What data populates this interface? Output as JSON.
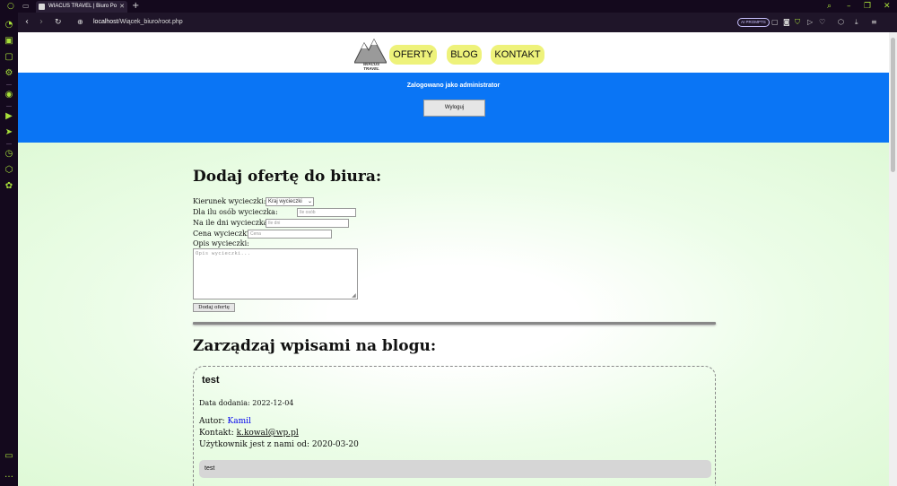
{
  "browser": {
    "tab_title": "WIACUS TRAVEL | Biuro Po",
    "url_host": "localhost",
    "url_path": "/Wiącek_biuro/root.php",
    "ai_prompts_label": "AI PROMPTS"
  },
  "nav": {
    "logo_text_line1": "WIACUS",
    "logo_text_line2": "TRAVEL",
    "items": [
      {
        "label": "OFERTY"
      },
      {
        "label": "BLOG"
      },
      {
        "label": "KONTAKT"
      }
    ]
  },
  "banner": {
    "admin_text": "Zalogowano jako administrator",
    "logout_label": "Wyloguj"
  },
  "offer_form": {
    "heading": "Dodaj ofertę do biura:",
    "direction_label": "Kierunek wycieczki:",
    "direction_value": "Kraj wycieczki",
    "people_label": "Dla ilu osób wycieczka:",
    "people_placeholder": "Ile osób",
    "days_label": "Na ile dni wycieczka:",
    "days_placeholder": "Ile dni",
    "price_label": "Cena wycieczki:",
    "price_placeholder": "Cena",
    "desc_label": "Opis wycieczki:",
    "desc_placeholder": "Opis wycieczki...",
    "submit_label": "Dodaj ofertę"
  },
  "blog": {
    "heading": "Zarządzaj wpisami na blogu:",
    "posts": [
      {
        "title": "test",
        "date_label": "Data dodania: 2022-12-04",
        "author_prefix": "Autor: ",
        "author": "Kamil",
        "contact_prefix": "Kontakt: ",
        "contact": "k.kowal@wp.pl",
        "since_label": "Użytkownik jest z nami od: 2020-03-20",
        "body": "test"
      }
    ]
  },
  "colors": {
    "banner": "#0a75f5",
    "nav_button": "#eef27a",
    "browser_accent": "#a8e03a"
  }
}
